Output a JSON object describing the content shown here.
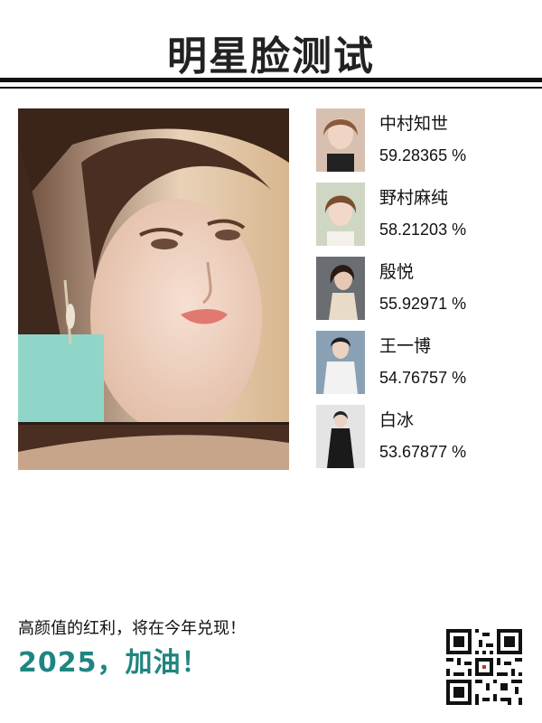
{
  "header": {
    "title": "明星脸测试"
  },
  "photo": {
    "alt": "uploaded face photo"
  },
  "results": [
    {
      "name": "中村知世",
      "percent": "59.28365 %",
      "thumb_icon": "actress-photo"
    },
    {
      "name": "野村麻纯",
      "percent": "58.21203 %",
      "thumb_icon": "actress-photo"
    },
    {
      "name": "殷悦",
      "percent": "55.92971 %",
      "thumb_icon": "actress-photo"
    },
    {
      "name": "王一博",
      "percent": "54.76757 %",
      "thumb_icon": "actor-photo"
    },
    {
      "name": "白冰",
      "percent": "53.67877 %",
      "thumb_icon": "actress-photo"
    }
  ],
  "footer": {
    "tagline": "高颜值的红利，将在今年兑现！",
    "slogan": "2025，加油！",
    "qr_icon": "qr-code-icon"
  },
  "colors": {
    "accent": "#1f8580",
    "rule": "#111111"
  }
}
